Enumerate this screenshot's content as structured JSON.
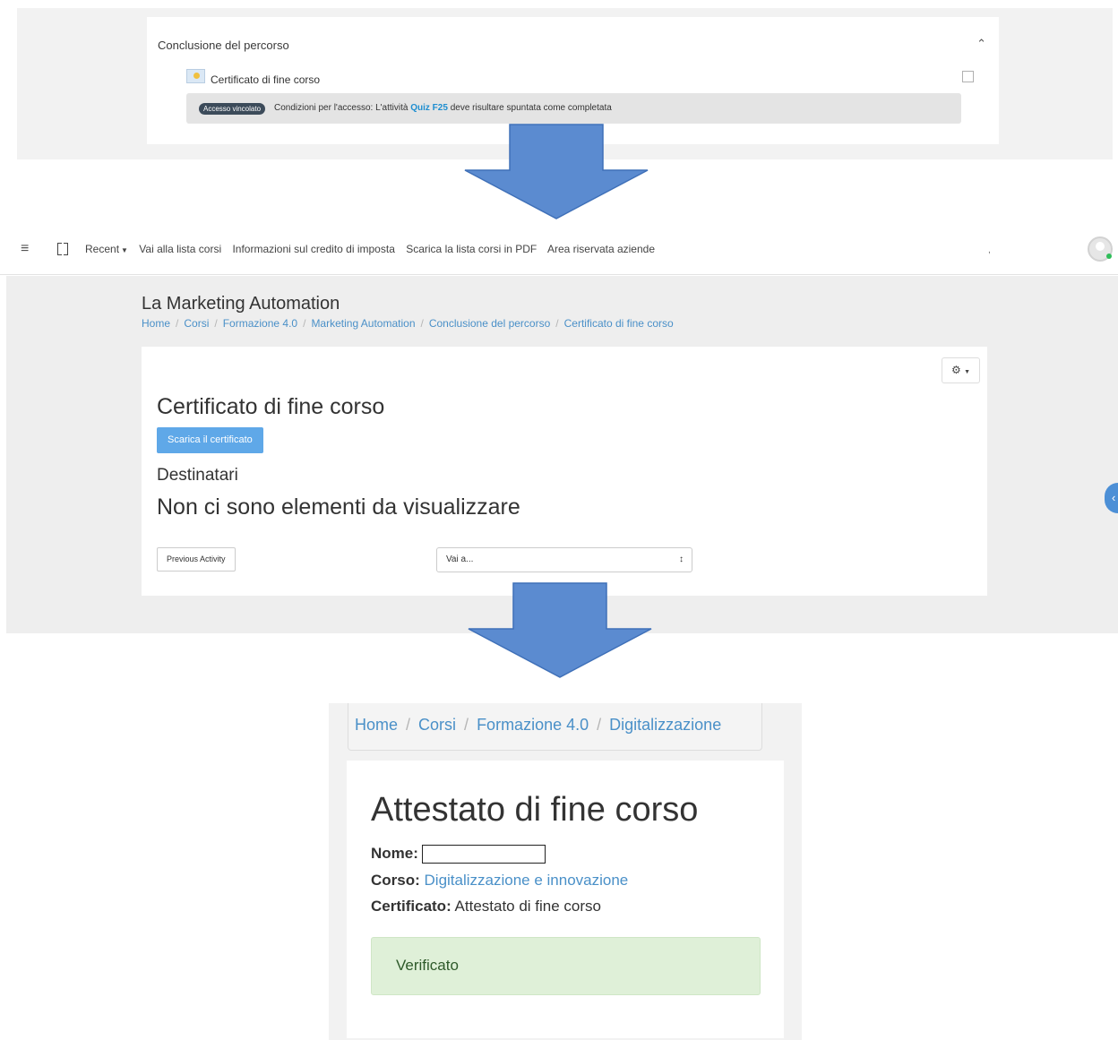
{
  "section": {
    "title": "Conclusione del percorso",
    "collapse_icon": "chevron-up-icon",
    "activity_label": "Certificato di fine corso",
    "restriction": {
      "badge": "Accesso vincolato",
      "text_before": "Condizioni per l'accesso: L'attività",
      "link": "Quiz F25",
      "text_after": "deve risultare spuntata come completata"
    }
  },
  "arrow_color": "#5b8bd0",
  "navbar": {
    "menu_icon": "hamburger-icon",
    "fullscreen_icon": "fullscreen-icon",
    "recent": "Recent",
    "links": [
      "Vai alla lista corsi",
      "Informazioni sul credito di imposta",
      "Scarica la lista corsi in PDF",
      "Area riservata aziende"
    ],
    "separator": ","
  },
  "activity_page": {
    "heading": "La Marketing Automation",
    "breadcrumb": [
      "Home",
      "Corsi",
      "Formazione 4.0",
      "Marketing Automation",
      "Conclusione del percorso",
      "Certificato di fine corso"
    ],
    "title": "Certificato di fine corso",
    "download_button": "Scarica il certificato",
    "recipients_heading": "Destinatari",
    "empty_message": "Non ci sono elementi da visualizzare",
    "previous_button": "Previous Activity",
    "jump_select": "Vai a..."
  },
  "verification": {
    "breadcrumb": [
      "Home",
      "Corsi",
      "Formazione 4.0",
      "Digitalizzazione"
    ],
    "title": "Attestato di fine corso",
    "name_label": "Nome:",
    "course_label": "Corso:",
    "course_value": "Digitalizzazione e innovazione",
    "certificate_label": "Certificato:",
    "certificate_value": "Attestato di fine corso",
    "status": "Verificato",
    "status_color": "#dff0d8"
  },
  "colors": {
    "link": "#4a90c8",
    "primary_button": "#5fa8e8",
    "badge": "#3c4b5a",
    "online": "#2ebd59"
  }
}
